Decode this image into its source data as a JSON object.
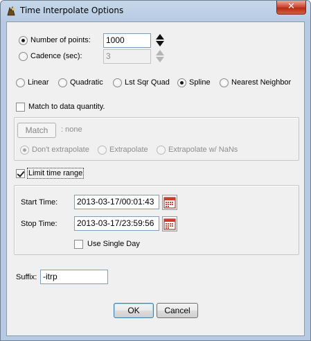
{
  "window": {
    "title": "Time Interpolate Options",
    "close_glyph": "✕"
  },
  "points_mode": {
    "number_of_points_label": "Number of points:",
    "number_of_points_value": "1000",
    "cadence_label": "Cadence (sec):",
    "cadence_value": "3",
    "selected": "number_of_points"
  },
  "method": {
    "options": [
      "Linear",
      "Quadratic",
      "Lst Sqr Quad",
      "Spline",
      "Nearest Neighbor"
    ],
    "selected": "Spline"
  },
  "match": {
    "checkbox_label": "Match to data quantity.",
    "checked": false,
    "button_label": "Match",
    "match_value": ": none",
    "extrapolate_options": [
      "Don't extrapolate",
      "Extrapolate",
      "Extrapolate w/ NaNs"
    ],
    "extrapolate_selected": "Don't extrapolate"
  },
  "time_range": {
    "checkbox_label": "Limit time range",
    "checked": true,
    "start_label": "Start Time:",
    "start_value": "2013-03-17/00:01:43",
    "stop_label": "Stop Time:",
    "stop_value": "2013-03-17/23:59:56",
    "single_day_label": "Use Single Day",
    "single_day_checked": false
  },
  "suffix": {
    "label": "Suffix:",
    "value": "-itrp"
  },
  "buttons": {
    "ok_label": "OK",
    "cancel_label": "Cancel"
  },
  "icons": {
    "app": "idl-app-icon",
    "calendar": "calendar-icon"
  },
  "colors": {
    "title_gradient": "#b6cbe3",
    "close_button": "#c7432c",
    "calendar_red": "#d23a2a"
  }
}
